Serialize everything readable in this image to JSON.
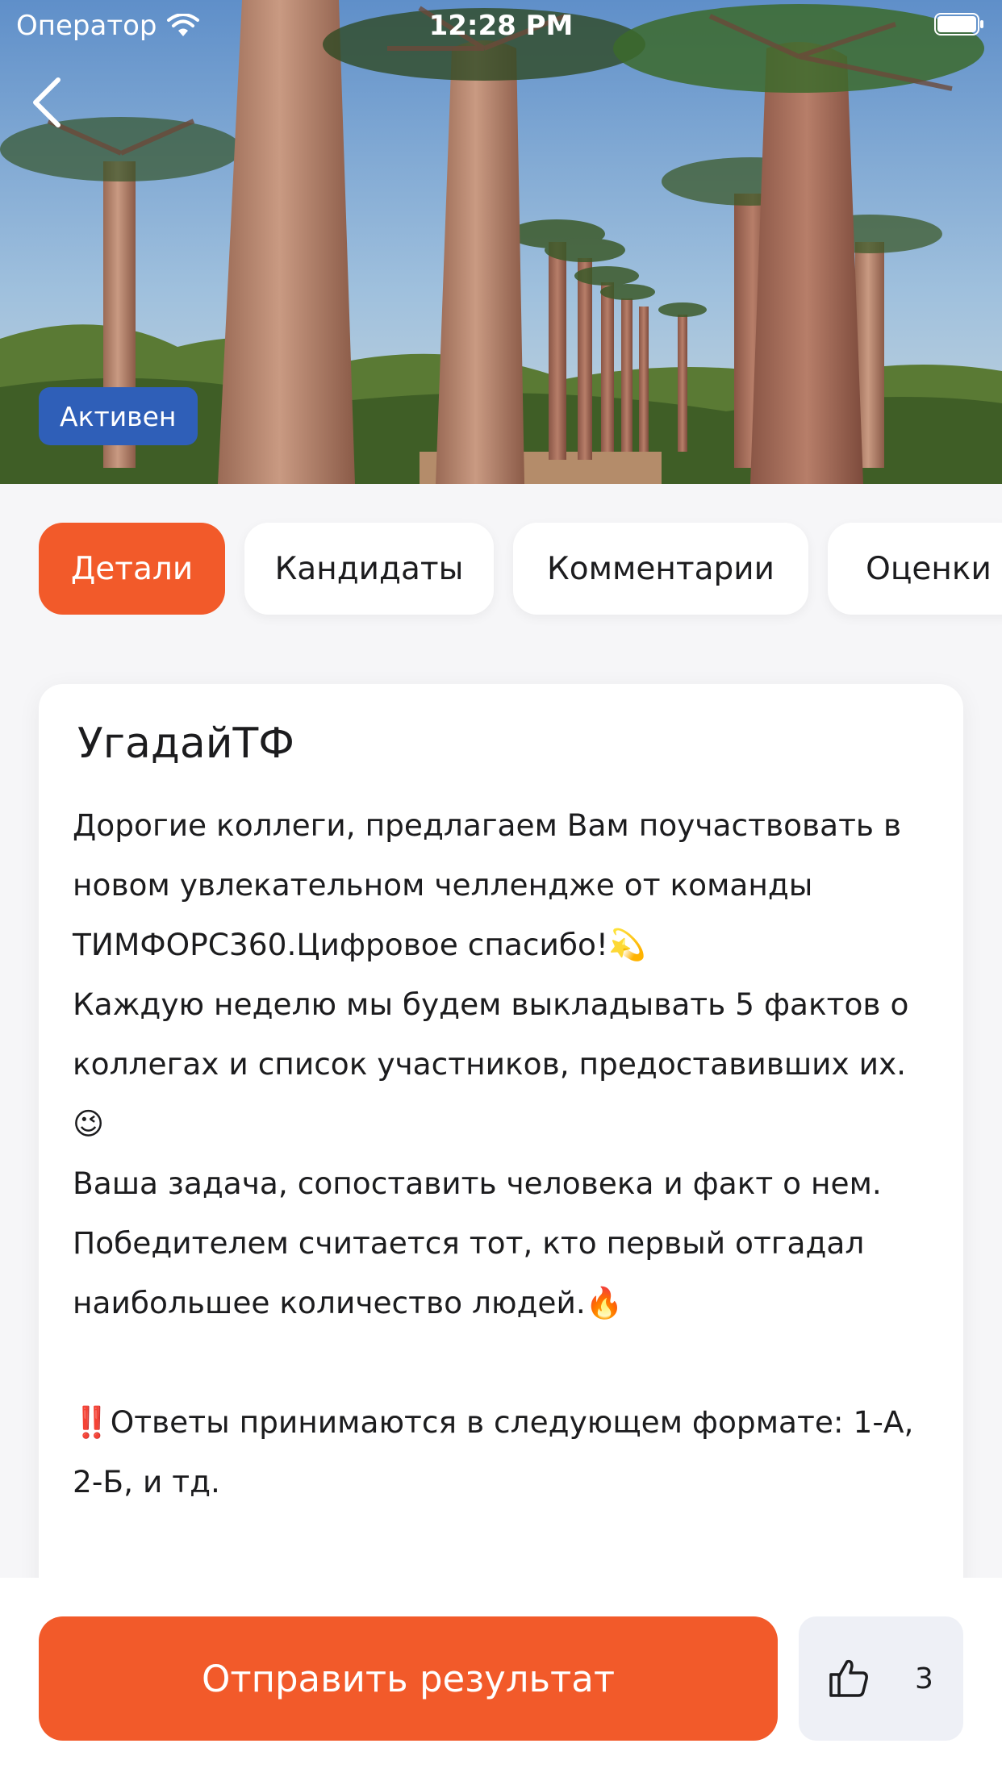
{
  "status_bar": {
    "carrier": "Оператор",
    "time": "12:28 PM"
  },
  "hero": {
    "status_chip": "Активен"
  },
  "tabs": [
    {
      "label": "Детали",
      "active": true
    },
    {
      "label": "Кандидаты",
      "active": false
    },
    {
      "label": "Комментарии",
      "active": false
    },
    {
      "label": "Оценки",
      "active": false
    }
  ],
  "card": {
    "title": "УгадайТФ",
    "paragraphs": [
      "Дорогие коллеги, предлагаем Вам поучаствовать в новом увлекательном челлендже от команды ТИМФОРС360.Цифровое спасибо!💫",
      "Каждую неделю мы будем выкладывать 5 фактов о коллегах и список участников, предоставивших их. 😉",
      "Ваша задача, сопоставить человека и факт о нем. Победителем считается тот, кто первый отгадал наибольшее количество людей.🔥",
      "",
      "‼️Ответы принимаются в следующем формате: 1-А, 2-Б, и тд."
    ]
  },
  "bottom": {
    "submit_label": "Отправить результат",
    "like_count": "3"
  },
  "colors": {
    "accent": "#f25a2a",
    "chip": "#2f5fb8",
    "like_bg": "#eef0f6",
    "background": "#f6f6f8"
  },
  "icons": {
    "back": "chevron-left-icon",
    "wifi": "wifi-icon",
    "battery": "battery-icon",
    "like": "thumbs-up-icon"
  }
}
